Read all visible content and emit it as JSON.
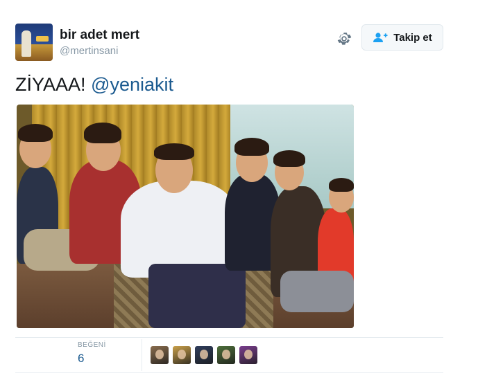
{
  "user": {
    "display_name": "bir adet mert",
    "handle": "@mertinsani"
  },
  "actions": {
    "follow_label": "Takip et"
  },
  "icons": {
    "settings": "gear-icon",
    "follow": "add-user-icon"
  },
  "tweet": {
    "text": "ZİYAAA!",
    "mention": "@yeniakit"
  },
  "stats": {
    "likes_label": "BEĞENİ",
    "likes_count": "6"
  },
  "likers": [
    {
      "color": "#8a6d4e"
    },
    {
      "color": "#c9a04a"
    },
    {
      "color": "#2f3d5c"
    },
    {
      "color": "#4d6e3a"
    },
    {
      "color": "#7a3e8e"
    }
  ],
  "colors": {
    "link": "#1b5a8f",
    "muted": "#8899a6",
    "accent": "#1da1f2"
  }
}
